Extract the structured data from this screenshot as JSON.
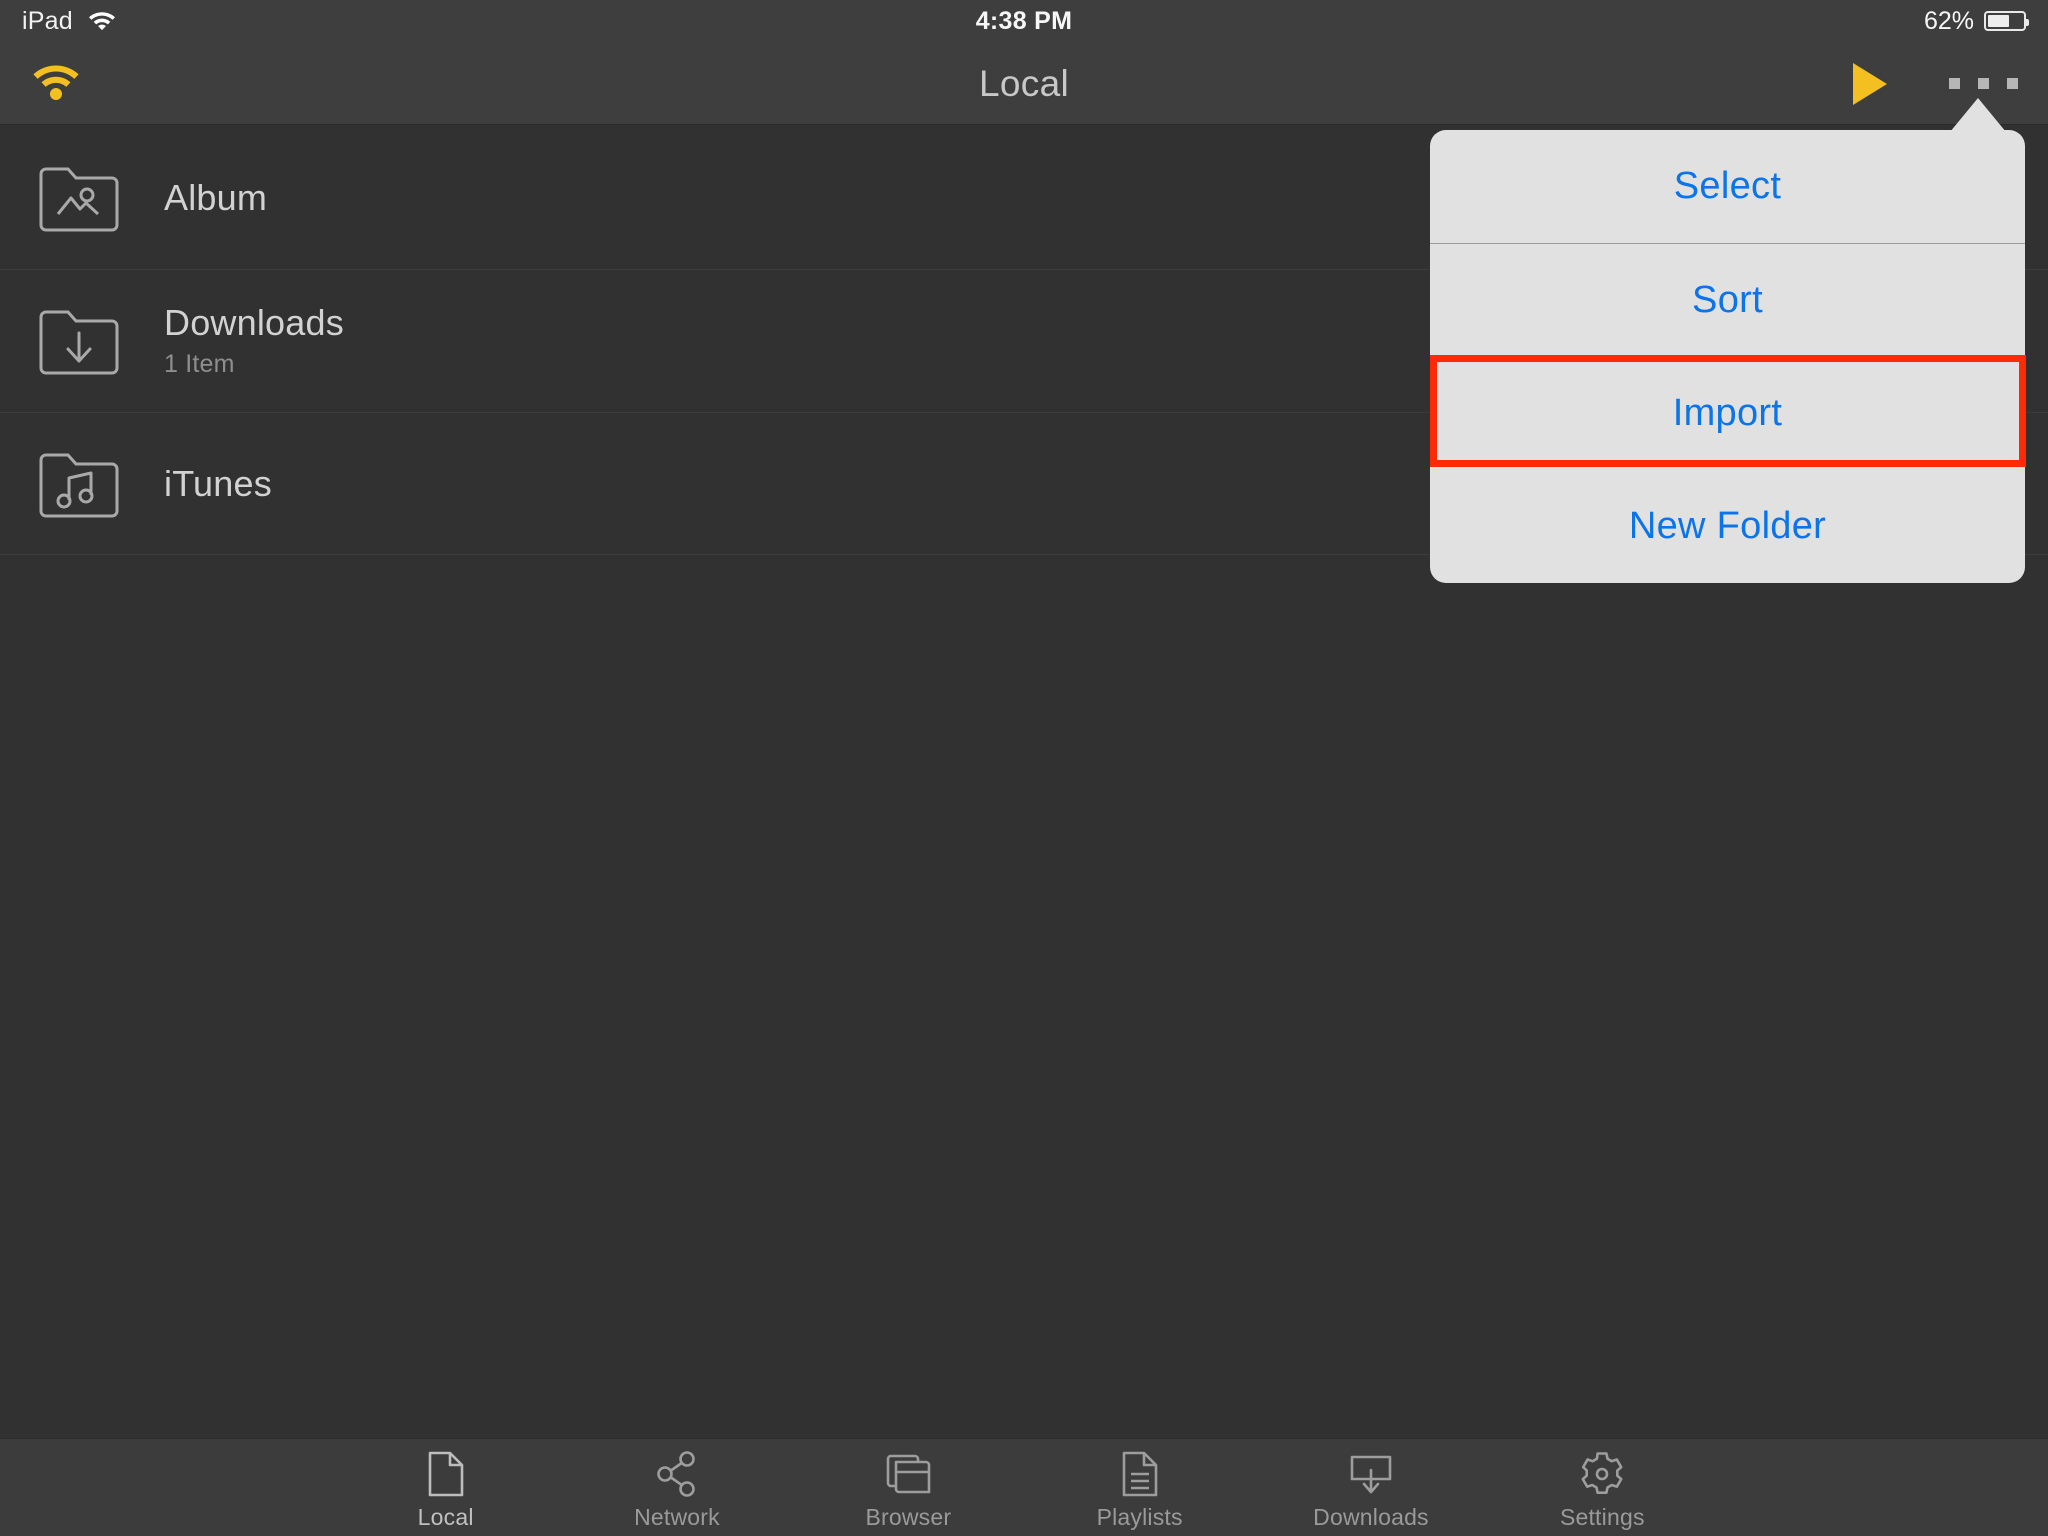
{
  "status_bar": {
    "device": "iPad",
    "wifi_icon": "wifi-icon",
    "time": "4:38 PM",
    "battery_percent": "62%",
    "battery_level": 62,
    "battery_icon": "battery-icon"
  },
  "nav_bar": {
    "title": "Local",
    "wifi_icon": "wifi-icon-yellow",
    "play_icon": "play-icon",
    "more_icon": "ellipsis-icon",
    "accent_color": "#f3bf21"
  },
  "file_list": {
    "rows": [
      {
        "name": "Album",
        "subtitle": "",
        "icon": "folder-photo-icon"
      },
      {
        "name": "Downloads",
        "subtitle": "1 Item",
        "icon": "folder-download-icon"
      },
      {
        "name": "iTunes",
        "subtitle": "",
        "icon": "folder-music-icon"
      }
    ]
  },
  "popover": {
    "items": [
      {
        "label": "Select",
        "highlighted": false
      },
      {
        "label": "Sort",
        "highlighted": false
      },
      {
        "label": "Import",
        "highlighted": true
      },
      {
        "label": "New Folder",
        "highlighted": false
      }
    ],
    "highlight_color": "#fc2b05",
    "text_color": "#0a74e8",
    "background_color": "#e1e1e1"
  },
  "tab_bar": {
    "tabs": [
      {
        "label": "Local",
        "icon": "document-icon",
        "active": true
      },
      {
        "label": "Network",
        "icon": "share-nodes-icon",
        "active": false
      },
      {
        "label": "Browser",
        "icon": "windows-stack-icon",
        "active": false
      },
      {
        "label": "Playlists",
        "icon": "document-lines-icon",
        "active": false
      },
      {
        "label": "Downloads",
        "icon": "download-tray-icon",
        "active": false
      },
      {
        "label": "Settings",
        "icon": "gear-icon",
        "active": false
      }
    ]
  }
}
